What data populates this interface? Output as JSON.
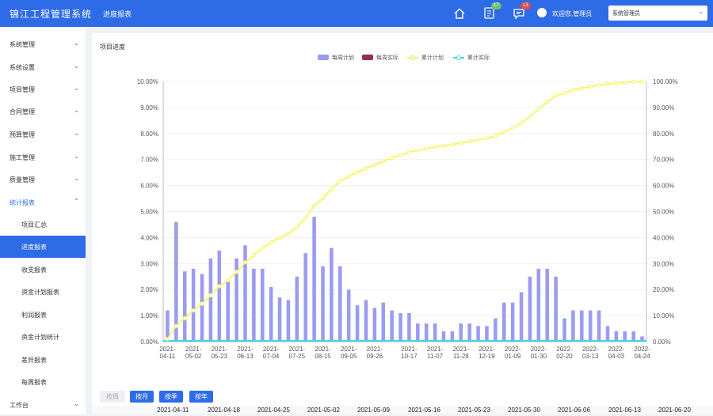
{
  "header": {
    "logo": "锦江工程管理系统",
    "tab": "进度报表",
    "icons": [
      "home-icon",
      "task-icon",
      "message-icon",
      "user-icon"
    ],
    "task_badge": "17",
    "message_badge": "13",
    "welcome": "欢迎您,管理员",
    "user_select": "系统管理员"
  },
  "sidebar": {
    "items": [
      {
        "label": "系统管理"
      },
      {
        "label": "系统设置"
      },
      {
        "label": "项目管理"
      },
      {
        "label": "合同管理"
      },
      {
        "label": "预算管理"
      },
      {
        "label": "施工管理"
      },
      {
        "label": "质量管理"
      },
      {
        "label": "统计报表"
      },
      {
        "label": "工作台"
      }
    ],
    "sub_items": [
      {
        "label": "项目汇总"
      },
      {
        "label": "进度报表"
      },
      {
        "label": "收支报表"
      },
      {
        "label": "资金计划报表"
      },
      {
        "label": "利润报表"
      },
      {
        "label": "资金计划统计"
      },
      {
        "label": "差异报表"
      },
      {
        "label": "每周报表"
      }
    ]
  },
  "panel": {
    "title": "项目进度"
  },
  "granularity": {
    "week": "按周",
    "month": "按月",
    "quarter": "按季",
    "year": "按年"
  },
  "date_row": [
    "2021-04-11",
    "2021-04-18",
    "2021-04-25",
    "2021-05-02",
    "2021-05-09",
    "2021-05-16",
    "2021-05-23",
    "2021-05-30",
    "2021-06-06",
    "2021-06-13",
    "2021-06-20"
  ],
  "colors": {
    "primary": "#2e6be6",
    "weekly_plan": "#9b9cf0",
    "weekly_actual": "#922b5a",
    "cumulative_plan": "#f5f570",
    "cumulative_actual": "#3fd6e6"
  },
  "chart_data": {
    "type": "bar",
    "legend_position": "top-center",
    "grid": true,
    "series": [
      {
        "name": "每周计划",
        "type": "bar",
        "axis": "left",
        "values": [
          1.2,
          4.6,
          2.7,
          2.8,
          2.6,
          3.2,
          3.5,
          2.3,
          3.2,
          3.7,
          2.8,
          2.8,
          2.1,
          1.7,
          1.6,
          2.5,
          3.4,
          4.8,
          2.9,
          3.6,
          2.9,
          2.0,
          1.4,
          1.6,
          1.3,
          1.5,
          1.2,
          1.1,
          1.1,
          0.7,
          0.7,
          0.7,
          0.4,
          0.4,
          0.7,
          0.7,
          0.6,
          0.6,
          0.9,
          1.5,
          1.5,
          1.9,
          2.5,
          2.8,
          2.8,
          2.5,
          0.9,
          1.2,
          1.2,
          1.2,
          1.2,
          0.6,
          0.4,
          0.4,
          0.4,
          0.2
        ]
      },
      {
        "name": "每周实际",
        "type": "bar",
        "axis": "left",
        "values": []
      },
      {
        "name": "累计计划",
        "type": "line",
        "axis": "right",
        "values": [
          1,
          6,
          9,
          12,
          14.6,
          17.8,
          21.3,
          23.6,
          26.8,
          30.5,
          33.3,
          36.1,
          38.2,
          39.9,
          41.5,
          44,
          47.4,
          52.2,
          55.1,
          58.7,
          61.6,
          63.6,
          65,
          66.6,
          67.9,
          69.4,
          70.6,
          71.7,
          72.8,
          73.5,
          74.2,
          74.9,
          75.3,
          75.7,
          76.4,
          77,
          77.6,
          78.2,
          79.1,
          80.6,
          82.1,
          84,
          86.5,
          89.3,
          92.1,
          94.6,
          95.5,
          96.7,
          97.4,
          98.1,
          98.6,
          99,
          99.3,
          99.6,
          99.9,
          100
        ]
      },
      {
        "name": "累计实际",
        "type": "line",
        "axis": "right",
        "values": []
      }
    ],
    "x_ticks": [
      "2021-04-11",
      "2021-05-02",
      "2021-05-23",
      "2021-06-13",
      "2021-07-04",
      "2021-07-25",
      "2021-08-15",
      "2021-09-05",
      "2021-09-26",
      "2021-10-17",
      "2021-11-07",
      "2021-11-28",
      "2021-12-19",
      "2022-01-09",
      "2022-01-30",
      "2022-02-20",
      "2022-03-13",
      "2022-04-03",
      "2022-04-24"
    ],
    "y_left_ticks": [
      "0.00%",
      "1.00%",
      "2.00%",
      "3.00%",
      "4.00%",
      "5.00%",
      "6.00%",
      "7.00%",
      "8.00%",
      "9.00%",
      "10.00%"
    ],
    "y_right_ticks": [
      "0.00%",
      "10.00%",
      "20.00%",
      "30.00%",
      "40.00%",
      "50.00%",
      "60.00%",
      "70.00%",
      "80.00%",
      "90.00%",
      "100.00%"
    ],
    "ylim_left": [
      0,
      10
    ],
    "ylim_right": [
      0,
      100
    ]
  }
}
